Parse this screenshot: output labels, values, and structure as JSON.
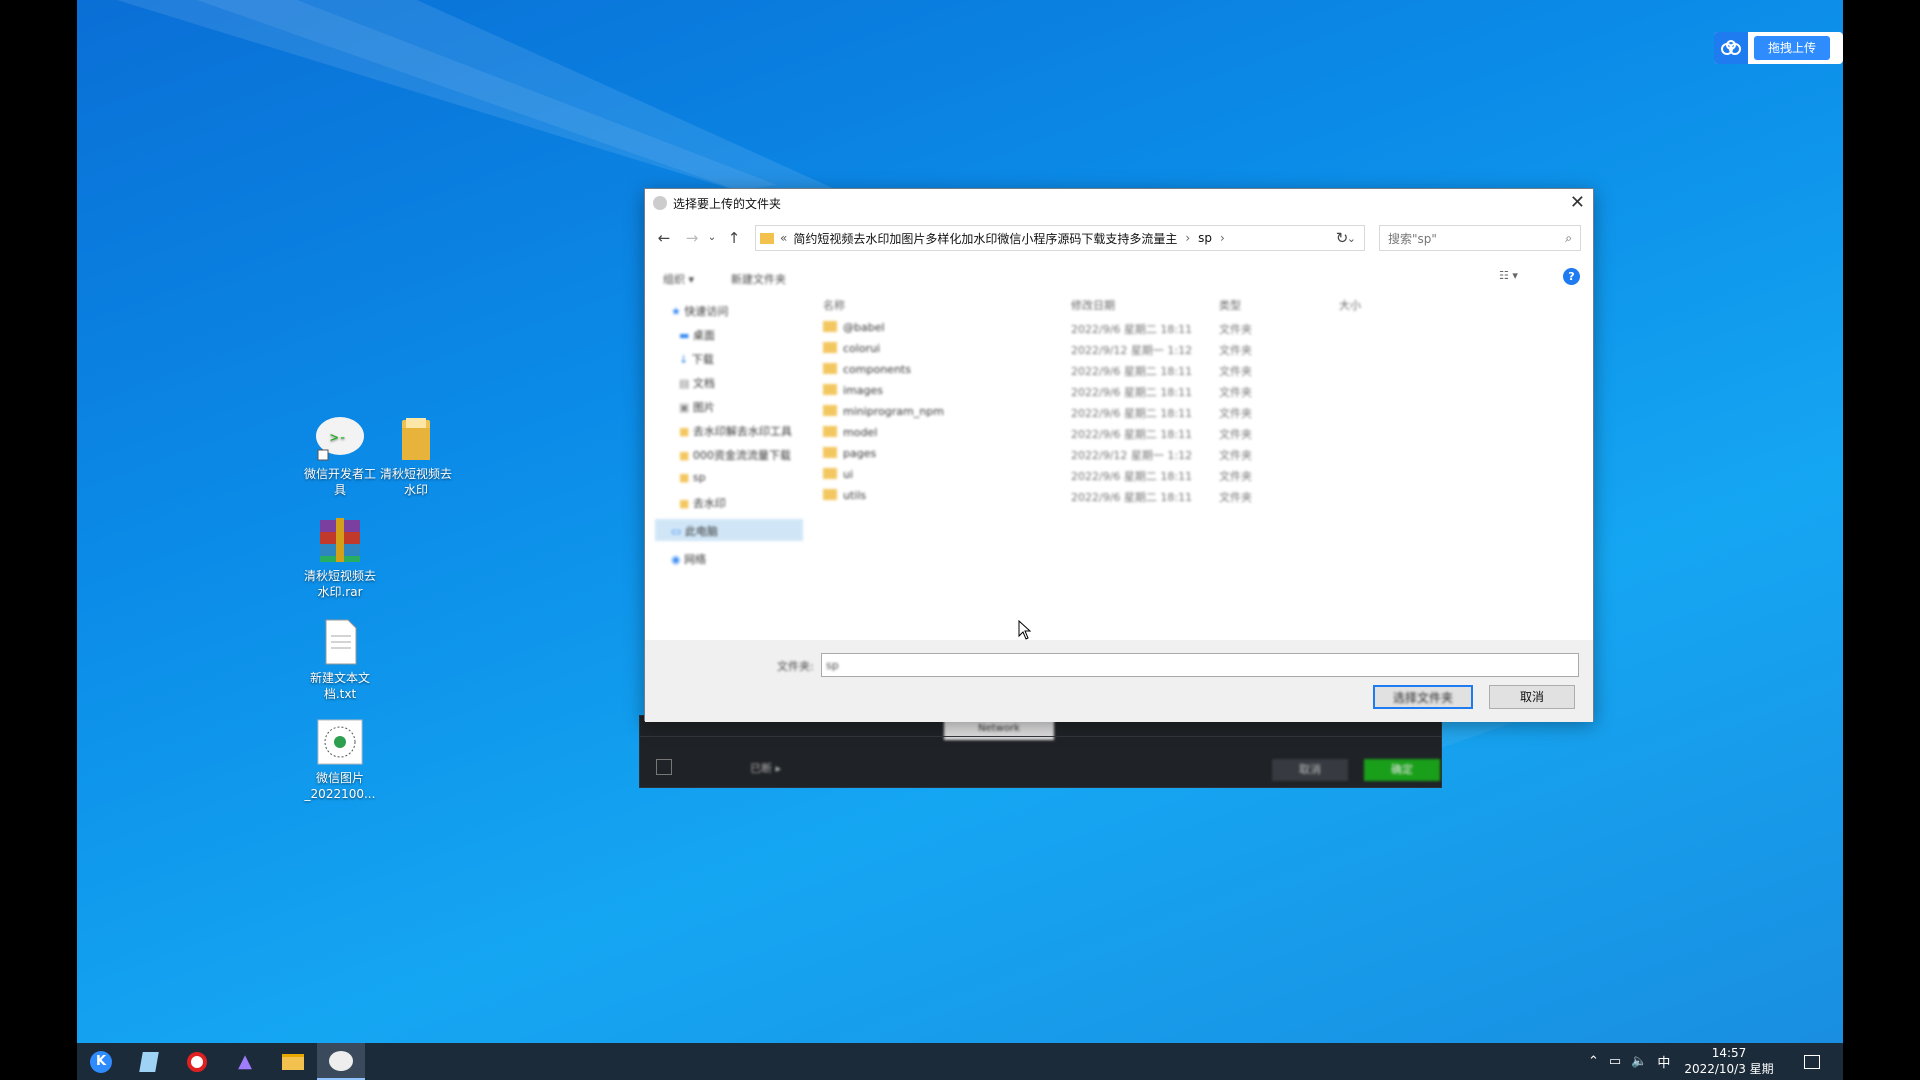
{
  "cloud_upload": {
    "label": "拖拽上传"
  },
  "desktop_icons": [
    {
      "label": "微信开发者工具"
    },
    {
      "label": "清秋短视频去水印"
    },
    {
      "label": "清秋短视频去水印.rar"
    },
    {
      "label": "新建文本文档.txt"
    },
    {
      "label": "微信图片_2022100..."
    }
  ],
  "dialog": {
    "title": "选择要上传的文件夹",
    "address_prefix": "«",
    "address_path": "简约短视频去水印加图片多样化加水印微信小程序源码下载支持多流量主",
    "address_current": "sp",
    "search_placeholder": "搜索\"sp\"",
    "toolbar": {
      "organize": "组织 ▾",
      "new_folder": "新建文件夹"
    },
    "nav_items": [
      {
        "label": "快速访问",
        "icon": "star-icon"
      },
      {
        "label": "桌面",
        "icon": "desktop-icon"
      },
      {
        "label": "下载",
        "icon": "download-icon"
      },
      {
        "label": "文档",
        "icon": "document-icon"
      },
      {
        "label": "图片",
        "icon": "image-icon"
      },
      {
        "label": "去水印解去水印工具",
        "icon": "folder-icon"
      },
      {
        "label": "000资金流流量下载",
        "icon": "folder-icon"
      },
      {
        "label": "sp",
        "icon": "folder-icon"
      },
      {
        "label": "去水印",
        "icon": "folder-icon"
      },
      {
        "label": "此电脑",
        "icon": "pc-icon"
      },
      {
        "label": "网络",
        "icon": "network-icon"
      }
    ],
    "columns": [
      "名称",
      "修改日期",
      "类型",
      "大小"
    ],
    "files": [
      {
        "name": "@babel",
        "date": "2022/9/6 星期二 18:11",
        "type": "文件夹"
      },
      {
        "name": "colorui",
        "date": "2022/9/12 星期一 1:12",
        "type": "文件夹"
      },
      {
        "name": "components",
        "date": "2022/9/6 星期二 18:11",
        "type": "文件夹"
      },
      {
        "name": "images",
        "date": "2022/9/6 星期二 18:11",
        "type": "文件夹"
      },
      {
        "name": "miniprogram_npm",
        "date": "2022/9/6 星期二 18:11",
        "type": "文件夹"
      },
      {
        "name": "model",
        "date": "2022/9/6 星期二 18:11",
        "type": "文件夹"
      },
      {
        "name": "pages",
        "date": "2022/9/12 星期一 1:12",
        "type": "文件夹"
      },
      {
        "name": "ui",
        "date": "2022/9/6 星期二 18:11",
        "type": "文件夹"
      },
      {
        "name": "utils",
        "date": "2022/9/6 星期二 18:11",
        "type": "文件夹"
      }
    ],
    "folder_label": "文件夹:",
    "folder_value": "sp",
    "select_button": "选择文件夹",
    "cancel_button": "取消"
  },
  "app_window": {
    "tab_label": "Network",
    "left_label": "已断 ▸",
    "cancel": "取消",
    "confirm": "确定"
  },
  "taskbar": {
    "time": "14:57",
    "date": "2022/10/3 星期一",
    "ime": "中"
  },
  "colors": {
    "accent": "#1e7bf0",
    "confirm_green": "#1aad19",
    "taskbar": "#1c2b3a"
  }
}
